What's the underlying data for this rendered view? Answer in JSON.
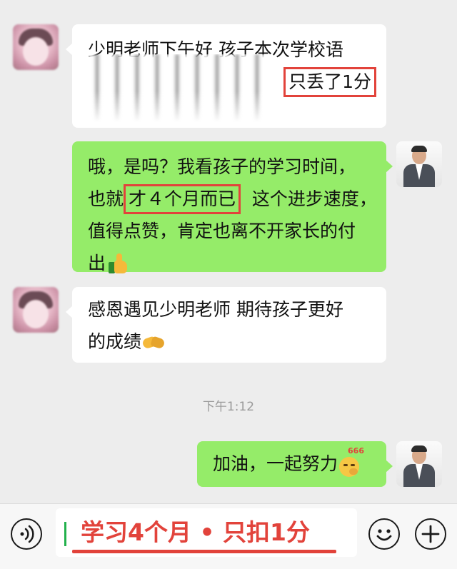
{
  "messages": [
    {
      "side": "left",
      "lines": [
        "少明老师下午好 孩子本次学校语"
      ],
      "highlight": "只丢了1分"
    },
    {
      "side": "right",
      "line1": "哦，是吗？我看孩子的学习时间，",
      "line2_prefix": "也就",
      "line2_highlight": "才４个月而已",
      "line2_suffix": "  这个进步速度，",
      "line3": "值得点赞，肯定也离不开家长的付",
      "line4": "出",
      "emoji": "thumbs-up-icon"
    },
    {
      "side": "left",
      "line1": "感恩遇见少明老师 期待孩子更好",
      "line2": "的成绩",
      "emoji": "handshake-icon"
    },
    {
      "side": "right",
      "text": "加油，一起努力",
      "emoji": "666-emoji-icon",
      "emoji_tag": "666"
    }
  ],
  "timestamp": "下午1:12",
  "input": {
    "text": "学习4个月 • 只扣1分"
  },
  "colors": {
    "chat_background": "#ededed",
    "received_bubble": "#ffffff",
    "sent_bubble": "#95ec69",
    "highlight": "#e2433b"
  }
}
